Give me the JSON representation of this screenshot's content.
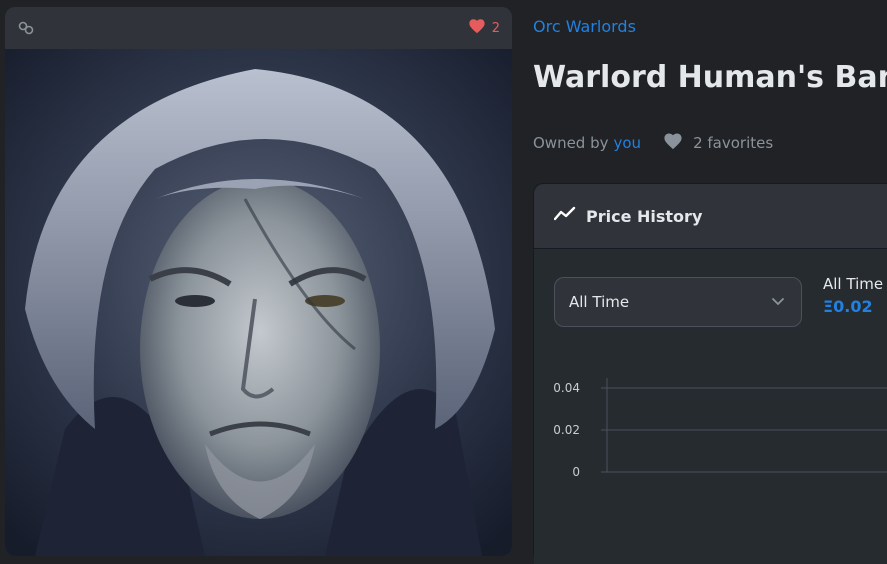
{
  "media": {
    "favorites_count": "2"
  },
  "item": {
    "collection_name": "Orc Warlords",
    "title": "Warlord Human's Bane",
    "owned_by_label": "Owned by",
    "owner": "you",
    "favorites_text": "2 favorites"
  },
  "price_history": {
    "title": "Price History",
    "time_filter": "All Time",
    "avg_label": "All Time A",
    "avg_value": "Ξ0.02"
  },
  "chart_data": {
    "type": "line",
    "y_ticks": [
      "0.04",
      "0.02",
      "0"
    ],
    "ylim": [
      0,
      0.04
    ],
    "series": []
  },
  "colors": {
    "accent": "#2081e2",
    "favorite": "#e65c5c",
    "background": "#202225"
  },
  "icons": {
    "chain": "chain-link-icon",
    "favorite_header": "heart-icon",
    "favorite_row": "heart-icon",
    "price_history": "trend-line-icon",
    "dropdown": "chevron-down-icon"
  }
}
